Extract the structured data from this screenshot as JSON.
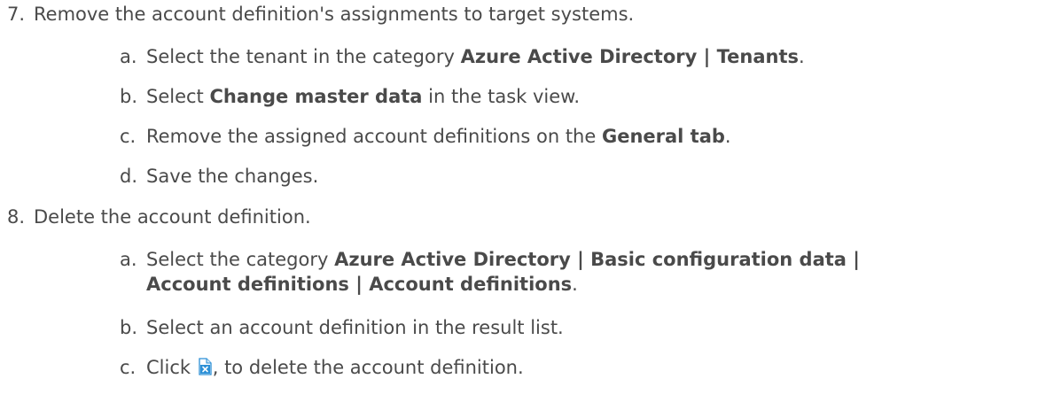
{
  "step7": {
    "number": "7.",
    "text": "Remove the account definition's assignments to target systems.",
    "substeps": [
      {
        "letter": "a.",
        "pre": "Select the tenant in the category ",
        "bold": "Azure Active Directory | Tenants",
        "post": "."
      },
      {
        "letter": "b.",
        "pre": "Select ",
        "bold": "Change master data",
        "post": " in the task view."
      },
      {
        "letter": "c.",
        "pre": "Remove the assigned account definitions on the ",
        "bold": "General tab",
        "post": "."
      },
      {
        "letter": "d.",
        "text": "Save the changes."
      }
    ]
  },
  "step8": {
    "number": "8.",
    "text": "Delete the account definition.",
    "substeps": [
      {
        "letter": "a.",
        "pre": "Select the category ",
        "bold_line1": "Azure Active Directory | Basic configuration data |",
        "bold_line2": "Account definitions | Account definitions",
        "post": "."
      },
      {
        "letter": "b.",
        "text": "Select an account definition in the result list."
      },
      {
        "letter": "c.",
        "pre": "Click ",
        "icon": "delete-document-icon",
        "post": ", to delete the account definition."
      }
    ]
  }
}
